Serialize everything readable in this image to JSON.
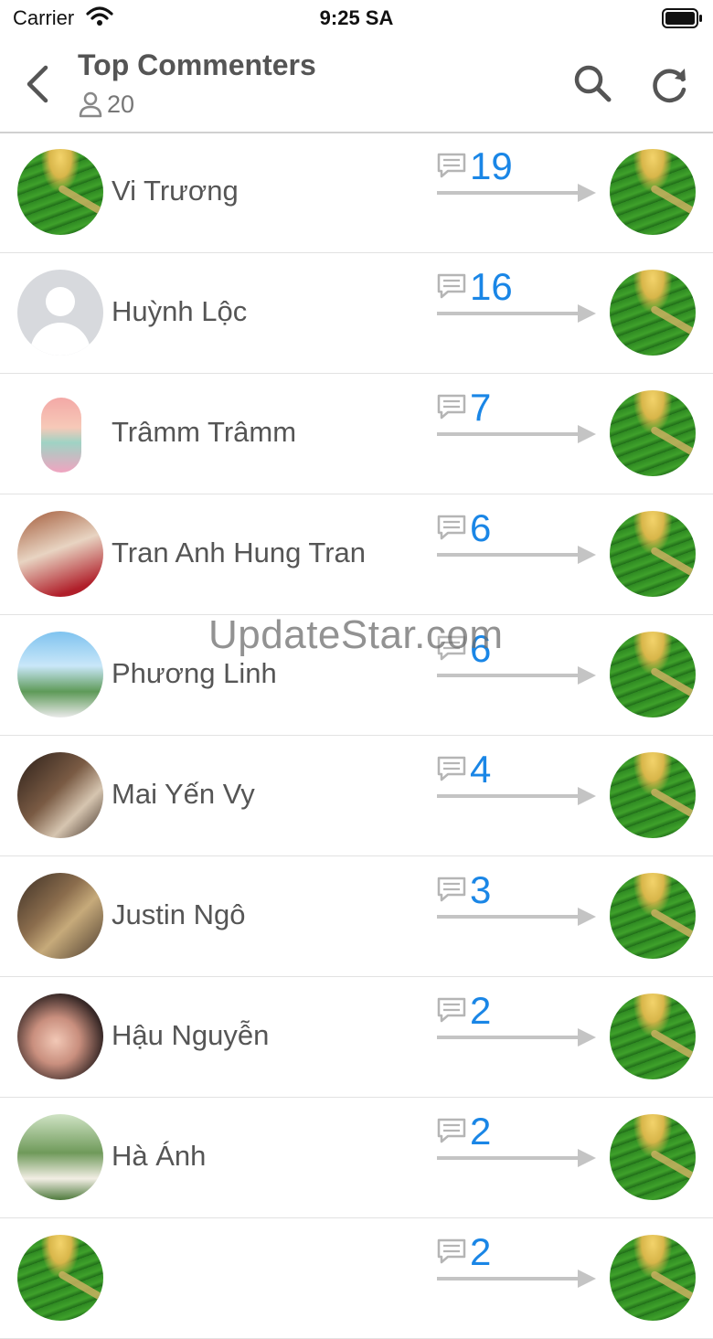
{
  "status": {
    "carrier": "Carrier",
    "time": "9:25 SA"
  },
  "header": {
    "title": "Top Commenters",
    "member_count": "20"
  },
  "watermark": "UpdateStar.com",
  "commenters": [
    {
      "name": "Vi Trương",
      "count": "19",
      "avatar": "landscape-photo"
    },
    {
      "name": "Huỳnh Lộc",
      "count": "16",
      "avatar": "default-user-placeholder"
    },
    {
      "name": "Trâmm Trâmm",
      "count": "7",
      "avatar": "cartoon-sticker"
    },
    {
      "name": "Tran Anh Hung Tran",
      "count": "6",
      "avatar": "photo"
    },
    {
      "name": "Phương Linh",
      "count": "6",
      "avatar": "photo"
    },
    {
      "name": "Mai Yến Vy",
      "count": "4",
      "avatar": "photo"
    },
    {
      "name": "Justin Ngô",
      "count": "3",
      "avatar": "photo"
    },
    {
      "name": "Hậu Nguyễn",
      "count": "2",
      "avatar": "photo"
    },
    {
      "name": "Hà Ánh",
      "count": "2",
      "avatar": "photo"
    },
    {
      "name": "",
      "count": "2",
      "avatar": "landscape-photo"
    }
  ],
  "colors": {
    "accent": "#1a86e6",
    "divider": "#e2e2e2",
    "icon_gray": "#555555"
  }
}
